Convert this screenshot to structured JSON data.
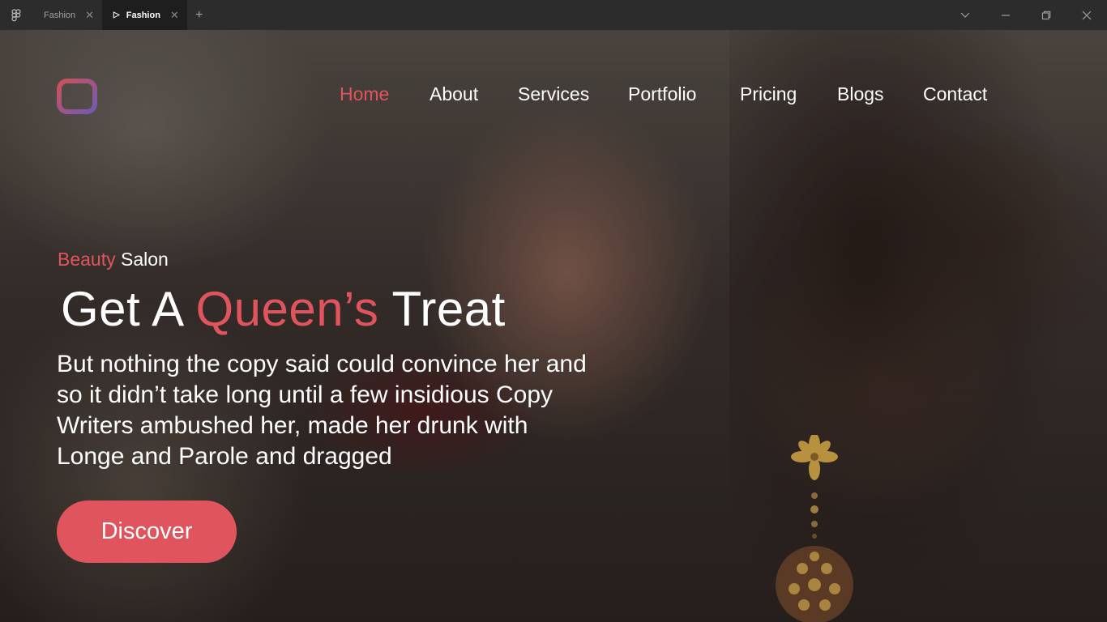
{
  "window": {
    "tabs": [
      {
        "label": "Fashion",
        "active": false
      },
      {
        "label": "Fashion",
        "active": true
      }
    ],
    "new_tab": "+",
    "close_glyph": "✕"
  },
  "site": {
    "nav": [
      "Home",
      "About",
      "Services",
      "Portfolio",
      "Pricing",
      "Blogs",
      "Contact"
    ],
    "active_nav": "Home",
    "kicker_accent": "Beauty",
    "kicker_rest": "Salon",
    "headline_start": "Get A",
    "headline_accent": "Queen’s",
    "headline_end": "Treat",
    "body": "But nothing the copy said could convince her and so it didn’t take long until a few insidious Copy Writers ambushed her, made her drunk with Longe and Parole and dragged",
    "cta": "Discover"
  },
  "colors": {
    "accent": "#e0555d",
    "text": "#ffffff",
    "titlebar": "#2c2c2c"
  },
  "icons": [
    "figma-icon",
    "play-icon",
    "close-icon",
    "plus-icon",
    "chevron-down-icon",
    "minimize-icon",
    "restore-icon",
    "window-close-icon",
    "logo-icon"
  ]
}
